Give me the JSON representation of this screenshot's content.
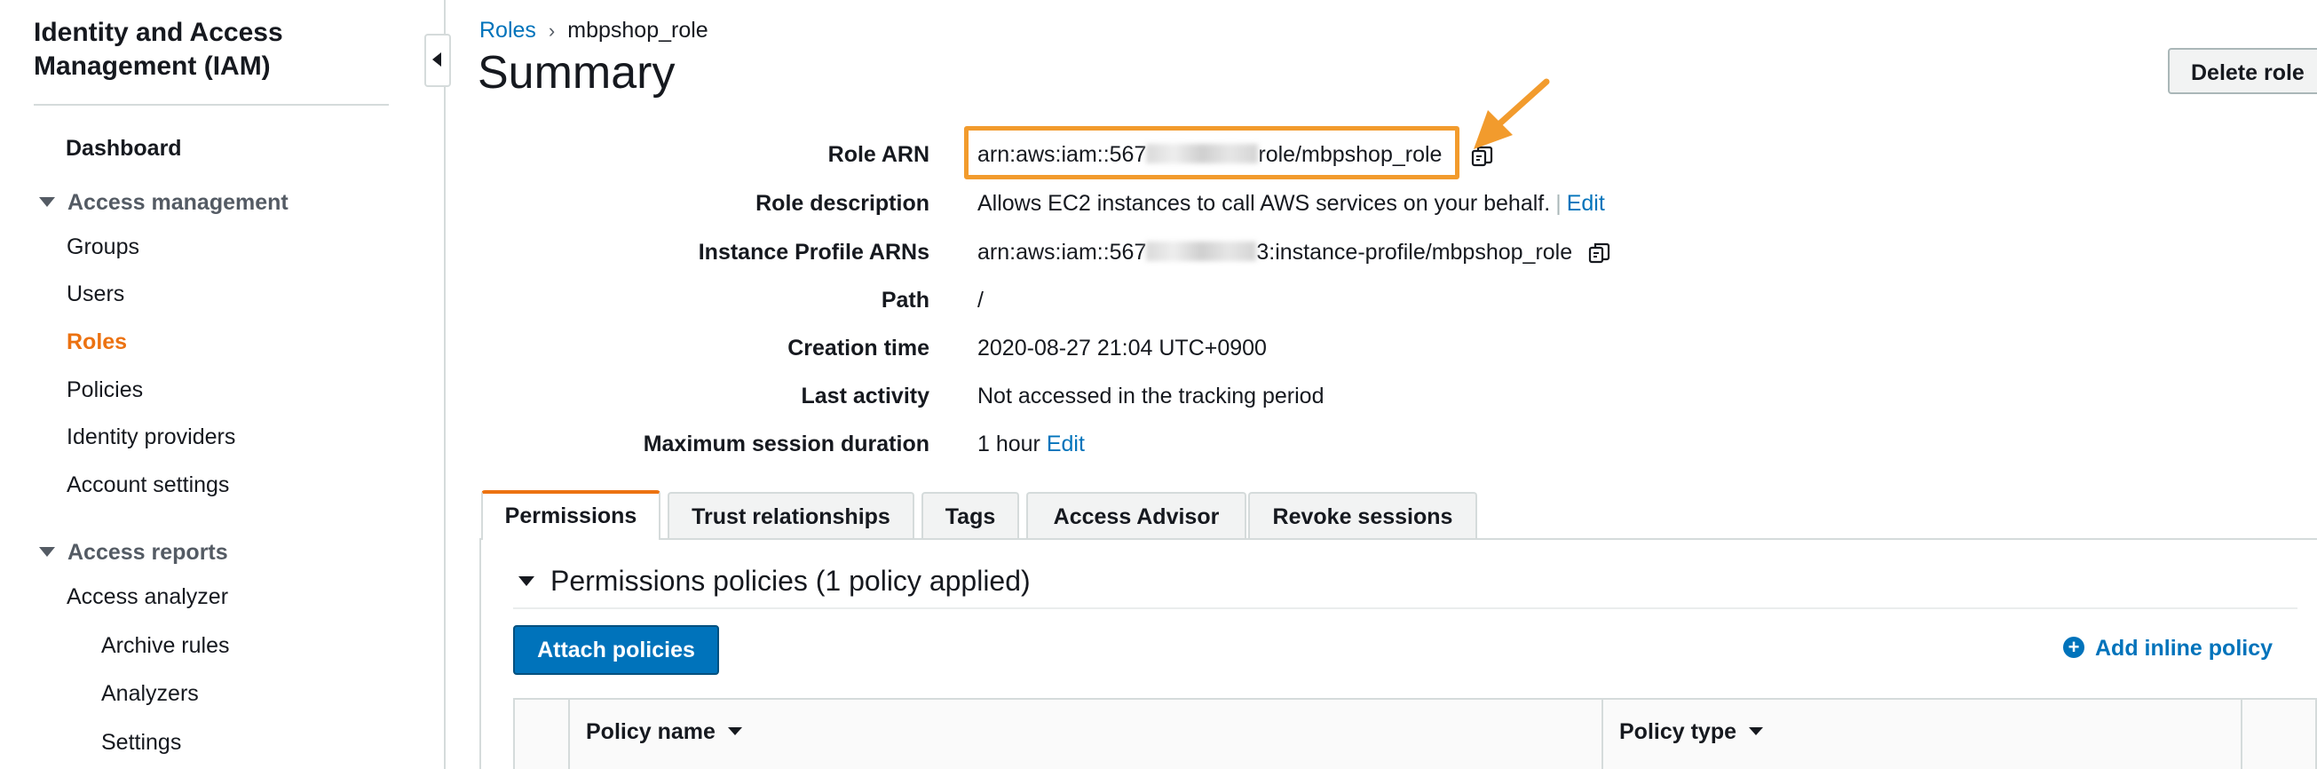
{
  "sidebar": {
    "title_line1": "Identity and Access",
    "title_line2": "Management (IAM)",
    "dashboard": "Dashboard",
    "access_management": {
      "label": "Access management",
      "items": [
        "Groups",
        "Users",
        "Roles",
        "Policies",
        "Identity providers",
        "Account settings"
      ],
      "active": "Roles"
    },
    "access_reports": {
      "label": "Access reports",
      "items": [
        "Access analyzer"
      ],
      "subitems": [
        "Archive rules",
        "Analyzers",
        "Settings"
      ]
    }
  },
  "breadcrumb": {
    "parent": "Roles",
    "current": "mbpshop_role"
  },
  "page_title": "Summary",
  "delete_button": "Delete role",
  "details": {
    "role_arn": {
      "label": "Role ARN",
      "value_prefix": "arn:aws:iam::567",
      "value_suffix": "role/mbpshop_role"
    },
    "role_description": {
      "label": "Role description",
      "value": "Allows EC2 instances to call AWS services on your behalf.",
      "separator": "|",
      "edit": "Edit"
    },
    "instance_profile": {
      "label": "Instance Profile ARNs",
      "value_prefix": "arn:aws:iam::567",
      "value_suffix": "3:instance-profile/mbpshop_role"
    },
    "path": {
      "label": "Path",
      "value": "/"
    },
    "creation_time": {
      "label": "Creation time",
      "value": "2020-08-27 21:04 UTC+0900"
    },
    "last_activity": {
      "label": "Last activity",
      "value": "Not accessed in the tracking period"
    },
    "max_session": {
      "label": "Maximum session duration",
      "value": "1 hour",
      "edit": "Edit"
    }
  },
  "tabs": {
    "permissions": "Permissions",
    "trust": "Trust relationships",
    "tags": "Tags",
    "advisor": "Access Advisor",
    "revoke": "Revoke sessions",
    "active": "Permissions"
  },
  "permissions": {
    "header": "Permissions policies (1 policy applied)",
    "attach_button": "Attach policies",
    "add_inline": "Add inline policy",
    "columns": [
      "Policy name",
      "Policy type"
    ]
  },
  "colors": {
    "accent": "#ec7211",
    "link": "#0073bb",
    "highlight": "#f29b2d"
  },
  "icons": [
    "collapse-sidebar-icon",
    "copy-icon",
    "plus-circle-icon",
    "caret-down-icon",
    "annotation-arrow"
  ]
}
